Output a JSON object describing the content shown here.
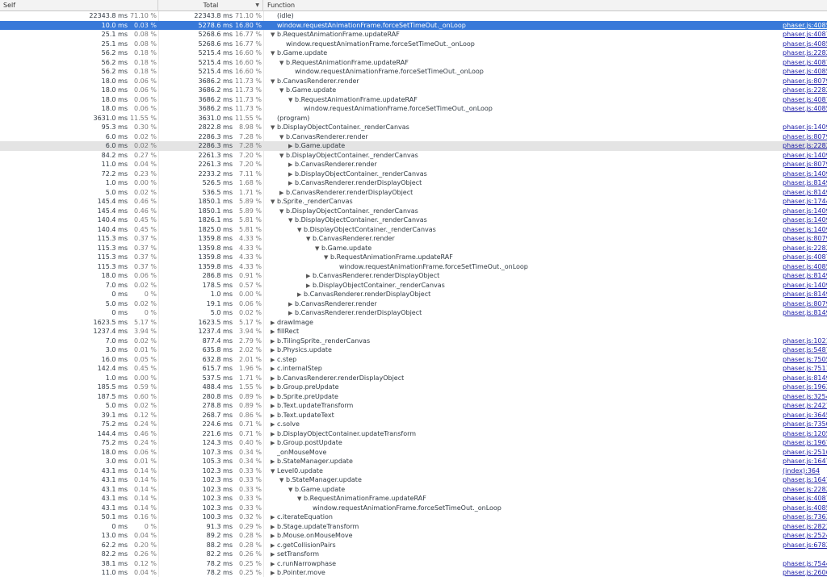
{
  "header": {
    "self": "Self",
    "total": "Total",
    "function": "Function",
    "sort_indicator": "▼"
  },
  "rows": [
    {
      "self": "22343.8 ms",
      "self_pct": "71.10 %",
      "total": "22343.8 ms",
      "total_pct": "71.10 %",
      "depth": 0,
      "toggle": "",
      "name": "(idle)",
      "url": ""
    },
    {
      "self": "10.0 ms",
      "self_pct": "0.03 %",
      "total": "5278.6 ms",
      "total_pct": "16.80 %",
      "depth": 0,
      "toggle": "",
      "name": "window.requestAnimationFrame.forceSetTimeOut._onLoop",
      "url": "phaser.js:40858",
      "selected": true
    },
    {
      "self": "25.1 ms",
      "self_pct": "0.08 %",
      "total": "5268.6 ms",
      "total_pct": "16.77 %",
      "depth": 0,
      "toggle": "▼",
      "name": "b.RequestAnimationFrame.updateRAF",
      "url": "phaser.js:40871"
    },
    {
      "self": "25.1 ms",
      "self_pct": "0.08 %",
      "total": "5268.6 ms",
      "total_pct": "16.77 %",
      "depth": 1,
      "toggle": "",
      "name": "window.requestAnimationFrame.forceSetTimeOut._onLoop",
      "url": "phaser.js:40858"
    },
    {
      "self": "56.2 ms",
      "self_pct": "0.18 %",
      "total": "5215.4 ms",
      "total_pct": "16.60 %",
      "depth": 0,
      "toggle": "▼",
      "name": "b.Game.update",
      "url": "phaser.js:22824"
    },
    {
      "self": "56.2 ms",
      "self_pct": "0.18 %",
      "total": "5215.4 ms",
      "total_pct": "16.60 %",
      "depth": 1,
      "toggle": "▼",
      "name": "b.RequestAnimationFrame.updateRAF",
      "url": "phaser.js:40871"
    },
    {
      "self": "56.2 ms",
      "self_pct": "0.18 %",
      "total": "5215.4 ms",
      "total_pct": "16.60 %",
      "depth": 2,
      "toggle": "",
      "name": "window.requestAnimationFrame.forceSetTimeOut._onLoop",
      "url": "phaser.js:40858"
    },
    {
      "self": "18.0 ms",
      "self_pct": "0.06 %",
      "total": "3686.2 ms",
      "total_pct": "11.73 %",
      "depth": 0,
      "toggle": "▼",
      "name": "b.CanvasRenderer.render",
      "url": "phaser.js:8079"
    },
    {
      "self": "18.0 ms",
      "self_pct": "0.06 %",
      "total": "3686.2 ms",
      "total_pct": "11.73 %",
      "depth": 1,
      "toggle": "▼",
      "name": "b.Game.update",
      "url": "phaser.js:22824"
    },
    {
      "self": "18.0 ms",
      "self_pct": "0.06 %",
      "total": "3686.2 ms",
      "total_pct": "11.73 %",
      "depth": 2,
      "toggle": "▼",
      "name": "b.RequestAnimationFrame.updateRAF",
      "url": "phaser.js:40871"
    },
    {
      "self": "18.0 ms",
      "self_pct": "0.06 %",
      "total": "3686.2 ms",
      "total_pct": "11.73 %",
      "depth": 3,
      "toggle": "",
      "name": "window.requestAnimationFrame.forceSetTimeOut._onLoop",
      "url": "phaser.js:40858"
    },
    {
      "self": "3631.0 ms",
      "self_pct": "11.55 %",
      "total": "3631.0 ms",
      "total_pct": "11.55 %",
      "depth": 0,
      "toggle": "",
      "name": "(program)",
      "url": ""
    },
    {
      "self": "95.3 ms",
      "self_pct": "0.30 %",
      "total": "2822.8 ms",
      "total_pct": "8.98 %",
      "depth": 0,
      "toggle": "▼",
      "name": "b.DisplayObjectContainer._renderCanvas",
      "url": "phaser.js:1409"
    },
    {
      "self": "6.0 ms",
      "self_pct": "0.02 %",
      "total": "2286.3 ms",
      "total_pct": "7.28 %",
      "depth": 1,
      "toggle": "▼",
      "name": "b.CanvasRenderer.render",
      "url": "phaser.js:8079"
    },
    {
      "self": "6.0 ms",
      "self_pct": "0.02 %",
      "total": "2286.3 ms",
      "total_pct": "7.28 %",
      "depth": 2,
      "toggle": "▶",
      "name": "b.Game.update",
      "url": "phaser.js:22824",
      "hover": true
    },
    {
      "self": "84.2 ms",
      "self_pct": "0.27 %",
      "total": "2261.3 ms",
      "total_pct": "7.20 %",
      "depth": 1,
      "toggle": "▼",
      "name": "b.DisplayObjectContainer._renderCanvas",
      "url": "phaser.js:1409"
    },
    {
      "self": "11.0 ms",
      "self_pct": "0.04 %",
      "total": "2261.3 ms",
      "total_pct": "7.20 %",
      "depth": 2,
      "toggle": "▶",
      "name": "b.CanvasRenderer.render",
      "url": "phaser.js:8079"
    },
    {
      "self": "72.2 ms",
      "self_pct": "0.23 %",
      "total": "2233.2 ms",
      "total_pct": "7.11 %",
      "depth": 2,
      "toggle": "▶",
      "name": "b.DisplayObjectContainer._renderCanvas",
      "url": "phaser.js:1409"
    },
    {
      "self": "1.0 ms",
      "self_pct": "0.00 %",
      "total": "526.5 ms",
      "total_pct": "1.68 %",
      "depth": 2,
      "toggle": "▶",
      "name": "b.CanvasRenderer.renderDisplayObject",
      "url": "phaser.js:8149"
    },
    {
      "self": "5.0 ms",
      "self_pct": "0.02 %",
      "total": "536.5 ms",
      "total_pct": "1.71 %",
      "depth": 1,
      "toggle": "▶",
      "name": "b.CanvasRenderer.renderDisplayObject",
      "url": "phaser.js:8149"
    },
    {
      "self": "145.4 ms",
      "self_pct": "0.46 %",
      "total": "1850.1 ms",
      "total_pct": "5.89 %",
      "depth": 0,
      "toggle": "▼",
      "name": "b.Sprite._renderCanvas",
      "url": "phaser.js:1744"
    },
    {
      "self": "145.4 ms",
      "self_pct": "0.46 %",
      "total": "1850.1 ms",
      "total_pct": "5.89 %",
      "depth": 1,
      "toggle": "▼",
      "name": "b.DisplayObjectContainer._renderCanvas",
      "url": "phaser.js:1409"
    },
    {
      "self": "140.4 ms",
      "self_pct": "0.45 %",
      "total": "1826.1 ms",
      "total_pct": "5.81 %",
      "depth": 2,
      "toggle": "▼",
      "name": "b.DisplayObjectContainer._renderCanvas",
      "url": "phaser.js:1409"
    },
    {
      "self": "140.4 ms",
      "self_pct": "0.45 %",
      "total": "1825.0 ms",
      "total_pct": "5.81 %",
      "depth": 3,
      "toggle": "▼",
      "name": "b.DisplayObjectContainer._renderCanvas",
      "url": "phaser.js:1409"
    },
    {
      "self": "115.3 ms",
      "self_pct": "0.37 %",
      "total": "1359.8 ms",
      "total_pct": "4.33 %",
      "depth": 4,
      "toggle": "▼",
      "name": "b.CanvasRenderer.render",
      "url": "phaser.js:8079"
    },
    {
      "self": "115.3 ms",
      "self_pct": "0.37 %",
      "total": "1359.8 ms",
      "total_pct": "4.33 %",
      "depth": 5,
      "toggle": "▼",
      "name": "b.Game.update",
      "url": "phaser.js:22824"
    },
    {
      "self": "115.3 ms",
      "self_pct": "0.37 %",
      "total": "1359.8 ms",
      "total_pct": "4.33 %",
      "depth": 6,
      "toggle": "▼",
      "name": "b.RequestAnimationFrame.updateRAF",
      "url": "phaser.js:40871"
    },
    {
      "self": "115.3 ms",
      "self_pct": "0.37 %",
      "total": "1359.8 ms",
      "total_pct": "4.33 %",
      "depth": 7,
      "toggle": "",
      "name": "window.requestAnimationFrame.forceSetTimeOut._onLoop",
      "url": "phaser.js:40858"
    },
    {
      "self": "18.0 ms",
      "self_pct": "0.06 %",
      "total": "286.8 ms",
      "total_pct": "0.91 %",
      "depth": 4,
      "toggle": "▶",
      "name": "b.CanvasRenderer.renderDisplayObject",
      "url": "phaser.js:8149"
    },
    {
      "self": "7.0 ms",
      "self_pct": "0.02 %",
      "total": "178.5 ms",
      "total_pct": "0.57 %",
      "depth": 4,
      "toggle": "▶",
      "name": "b.DisplayObjectContainer._renderCanvas",
      "url": "phaser.js:1409"
    },
    {
      "self": "0 ms",
      "self_pct": "0 %",
      "total": "1.0 ms",
      "total_pct": "0.00 %",
      "depth": 3,
      "toggle": "▶",
      "name": "b.CanvasRenderer.renderDisplayObject",
      "url": "phaser.js:8149"
    },
    {
      "self": "5.0 ms",
      "self_pct": "0.02 %",
      "total": "19.1 ms",
      "total_pct": "0.06 %",
      "depth": 2,
      "toggle": "▶",
      "name": "b.CanvasRenderer.render",
      "url": "phaser.js:8079"
    },
    {
      "self": "0 ms",
      "self_pct": "0 %",
      "total": "5.0 ms",
      "total_pct": "0.02 %",
      "depth": 2,
      "toggle": "▶",
      "name": "b.CanvasRenderer.renderDisplayObject",
      "url": "phaser.js:8149"
    },
    {
      "self": "1623.5 ms",
      "self_pct": "5.17 %",
      "total": "1623.5 ms",
      "total_pct": "5.17 %",
      "depth": 0,
      "toggle": "▶",
      "name": "drawImage",
      "url": ""
    },
    {
      "self": "1237.4 ms",
      "self_pct": "3.94 %",
      "total": "1237.4 ms",
      "total_pct": "3.94 %",
      "depth": 0,
      "toggle": "▶",
      "name": "fillRect",
      "url": ""
    },
    {
      "self": "7.0 ms",
      "self_pct": "0.02 %",
      "total": "877.4 ms",
      "total_pct": "2.79 %",
      "depth": 0,
      "toggle": "▶",
      "name": "b.TilingSprite._renderCanvas",
      "url": "phaser.js:10219"
    },
    {
      "self": "3.0 ms",
      "self_pct": "0.01 %",
      "total": "635.8 ms",
      "total_pct": "2.02 %",
      "depth": 0,
      "toggle": "▶",
      "name": "b.Physics.update",
      "url": "phaser.js:54875"
    },
    {
      "self": "16.0 ms",
      "self_pct": "0.05 %",
      "total": "632.8 ms",
      "total_pct": "2.01 %",
      "depth": 0,
      "toggle": "▶",
      "name": "c.step",
      "url": "phaser.js:75057"
    },
    {
      "self": "142.4 ms",
      "self_pct": "0.45 %",
      "total": "615.7 ms",
      "total_pct": "1.96 %",
      "depth": 0,
      "toggle": "▶",
      "name": "c.internalStep",
      "url": "phaser.js:75117"
    },
    {
      "self": "1.0 ms",
      "self_pct": "0.00 %",
      "total": "537.5 ms",
      "total_pct": "1.71 %",
      "depth": 0,
      "toggle": "▶",
      "name": "b.CanvasRenderer.renderDisplayObject",
      "url": "phaser.js:8149"
    },
    {
      "self": "185.5 ms",
      "self_pct": "0.59 %",
      "total": "488.4 ms",
      "total_pct": "1.55 %",
      "depth": 0,
      "toggle": "▶",
      "name": "b.Group.preUpdate",
      "url": "phaser.js:19631"
    },
    {
      "self": "187.5 ms",
      "self_pct": "0.60 %",
      "total": "280.8 ms",
      "total_pct": "0.89 %",
      "depth": 0,
      "toggle": "▶",
      "name": "b.Sprite.preUpdate",
      "url": "phaser.js:32541"
    },
    {
      "self": "5.0 ms",
      "self_pct": "0.02 %",
      "total": "278.8 ms",
      "total_pct": "0.89 %",
      "depth": 0,
      "toggle": "▶",
      "name": "b.Text.updateTransform",
      "url": "phaser.js:2427"
    },
    {
      "self": "39.1 ms",
      "self_pct": "0.12 %",
      "total": "268.7 ms",
      "total_pct": "0.86 %",
      "depth": 0,
      "toggle": "▶",
      "name": "b.Text.updateText",
      "url": "phaser.js:36456"
    },
    {
      "self": "75.2 ms",
      "self_pct": "0.24 %",
      "total": "224.6 ms",
      "total_pct": "0.71 %",
      "depth": 0,
      "toggle": "▶",
      "name": "c.solve",
      "url": "phaser.js:73500"
    },
    {
      "self": "144.4 ms",
      "self_pct": "0.46 %",
      "total": "221.6 ms",
      "total_pct": "0.71 %",
      "depth": 0,
      "toggle": "▶",
      "name": "b.DisplayObjectContainer.updateTransform",
      "url": "phaser.js:1205"
    },
    {
      "self": "75.2 ms",
      "self_pct": "0.24 %",
      "total": "124.3 ms",
      "total_pct": "0.40 %",
      "depth": 0,
      "toggle": "▶",
      "name": "b.Group.postUpdate",
      "url": "phaser.js:19671"
    },
    {
      "self": "18.0 ms",
      "self_pct": "0.06 %",
      "total": "107.3 ms",
      "total_pct": "0.34 %",
      "depth": 0,
      "toggle": "",
      "name": "_onMouseMove",
      "url": "phaser.js:25168"
    },
    {
      "self": "3.0 ms",
      "self_pct": "0.01 %",
      "total": "105.3 ms",
      "total_pct": "0.34 %",
      "depth": 0,
      "toggle": "▶",
      "name": "b.StateManager.update",
      "url": "phaser.js:16478"
    },
    {
      "self": "43.1 ms",
      "self_pct": "0.14 %",
      "total": "102.3 ms",
      "total_pct": "0.33 %",
      "depth": 0,
      "toggle": "▼",
      "name": "Level0.update",
      "url": "(index):364"
    },
    {
      "self": "43.1 ms",
      "self_pct": "0.14 %",
      "total": "102.3 ms",
      "total_pct": "0.33 %",
      "depth": 1,
      "toggle": "▼",
      "name": "b.StateManager.update",
      "url": "phaser.js:16478"
    },
    {
      "self": "43.1 ms",
      "self_pct": "0.14 %",
      "total": "102.3 ms",
      "total_pct": "0.33 %",
      "depth": 2,
      "toggle": "▼",
      "name": "b.Game.update",
      "url": "phaser.js:22824"
    },
    {
      "self": "43.1 ms",
      "self_pct": "0.14 %",
      "total": "102.3 ms",
      "total_pct": "0.33 %",
      "depth": 3,
      "toggle": "▼",
      "name": "b.RequestAnimationFrame.updateRAF",
      "url": "phaser.js:40871"
    },
    {
      "self": "43.1 ms",
      "self_pct": "0.14 %",
      "total": "102.3 ms",
      "total_pct": "0.33 %",
      "depth": 4,
      "toggle": "",
      "name": "window.requestAnimationFrame.forceSetTimeOut._onLoop",
      "url": "phaser.js:40858"
    },
    {
      "self": "50.1 ms",
      "self_pct": "0.16 %",
      "total": "100.3 ms",
      "total_pct": "0.32 %",
      "depth": 0,
      "toggle": "▶",
      "name": "c.iterateEquation",
      "url": "phaser.js:73638"
    },
    {
      "self": "0 ms",
      "self_pct": "0 %",
      "total": "91.3 ms",
      "total_pct": "0.29 %",
      "depth": 0,
      "toggle": "▶",
      "name": "b.Stage.updateTransform",
      "url": "phaser.js:2823"
    },
    {
      "self": "13.0 ms",
      "self_pct": "0.04 %",
      "total": "89.2 ms",
      "total_pct": "0.28 %",
      "depth": 0,
      "toggle": "▶",
      "name": "b.Mouse.onMouseMove",
      "url": "phaser.js:25244"
    },
    {
      "self": "62.2 ms",
      "self_pct": "0.20 %",
      "total": "88.2 ms",
      "total_pct": "0.28 %",
      "depth": 0,
      "toggle": "▶",
      "name": "c.getCollisionPairs",
      "url": "phaser.js:67827"
    },
    {
      "self": "82.2 ms",
      "self_pct": "0.26 %",
      "total": "82.2 ms",
      "total_pct": "0.26 %",
      "depth": 0,
      "toggle": "▶",
      "name": "setTransform",
      "url": ""
    },
    {
      "self": "38.1 ms",
      "self_pct": "0.12 %",
      "total": "78.2 ms",
      "total_pct": "0.25 %",
      "depth": 0,
      "toggle": "▶",
      "name": "c.runNarrowphase",
      "url": "phaser.js:75441"
    },
    {
      "self": "11.0 ms",
      "self_pct": "0.04 %",
      "total": "78.2 ms",
      "total_pct": "0.25 %",
      "depth": 0,
      "toggle": "▶",
      "name": "b.Pointer.move",
      "url": "phaser.js:26061"
    }
  ]
}
